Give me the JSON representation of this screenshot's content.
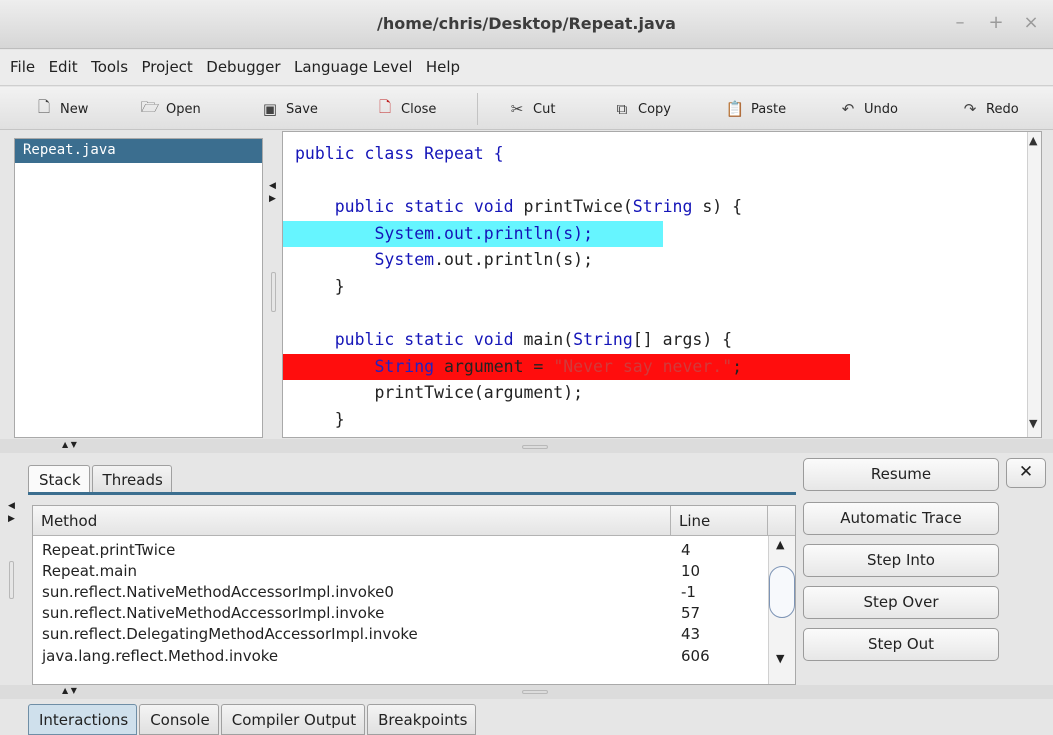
{
  "window": {
    "title": "/home/chris/Desktop/Repeat.java",
    "controls": [
      "–",
      "+",
      "×"
    ]
  },
  "menu": [
    "File",
    "Edit",
    "Tools",
    "Project",
    "Debugger",
    "Language Level",
    "Help"
  ],
  "toolbar": {
    "new": "New",
    "open": "Open",
    "save": "Save",
    "close": "Close",
    "cut": "Cut",
    "copy": "Copy",
    "paste": "Paste",
    "undo": "Undo",
    "redo": "Redo"
  },
  "files": [
    "Repeat.java"
  ],
  "code": {
    "l1": "public class Repeat {",
    "l3_kw": "public static void",
    "l3_rest": " printTwice(",
    "l3_type": "String",
    "l3_end": " s) {",
    "l4a": "System",
    "l4b": ".out.println(s);",
    "l5a": "System",
    "l5b": ".out.println(s);",
    "l6": "}",
    "l8_kw": "public static void",
    "l8_rest": " main(",
    "l8_type": "String",
    "l8_end": "[] args) {",
    "l9_type": "String",
    "l9_mid": " argument = ",
    "l9_str": "\"Never say never.\"",
    "l9_end": ";",
    "l10": "printTwice(argument);",
    "l11": "}"
  },
  "debugger": {
    "tabs": [
      "Stack",
      "Threads"
    ],
    "columns": {
      "method": "Method",
      "line": "Line"
    },
    "rows": [
      {
        "method": "Repeat.printTwice",
        "line": "4"
      },
      {
        "method": "Repeat.main",
        "line": "10"
      },
      {
        "method": "sun.reflect.NativeMethodAccessorImpl.invoke0",
        "line": "-1"
      },
      {
        "method": "sun.reflect.NativeMethodAccessorImpl.invoke",
        "line": "57"
      },
      {
        "method": "sun.reflect.DelegatingMethodAccessorImpl.invoke",
        "line": "43"
      },
      {
        "method": "java.lang.reflect.Method.invoke",
        "line": "606"
      }
    ],
    "buttons": [
      "Resume",
      "Automatic Trace",
      "Step Into",
      "Step Over",
      "Step Out"
    ],
    "close": "✕"
  },
  "bottom_tabs": [
    "Interactions",
    "Console",
    "Compiler Output",
    "Breakpoints"
  ],
  "colors": {
    "selection": "#3b6e8f",
    "current_line": "#66f5ff",
    "breakpoint": "#ff0d0d",
    "keyword": "#1515b8"
  }
}
